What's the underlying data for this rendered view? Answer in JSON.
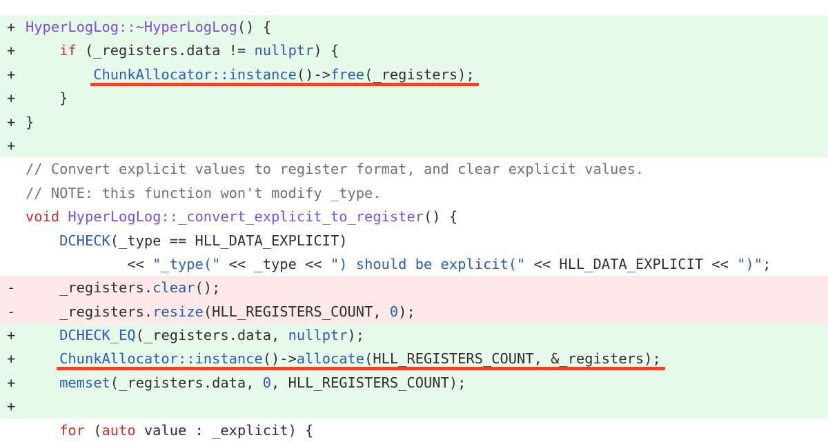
{
  "view": "code-diff",
  "colors": {
    "added_background": "#e8fbea",
    "removed_background": "#fde9e7",
    "context_background": "#ffffff",
    "highlight_underline": "#e8442a"
  },
  "lines": [
    {
      "kind": "add",
      "marker": "+",
      "tokens": [
        {
          "t": "HyperLogLog::~HyperLogLog",
          "c": "type"
        },
        {
          "t": "() {",
          "c": "plain"
        }
      ]
    },
    {
      "kind": "add",
      "marker": "+",
      "tokens": [
        {
          "t": "    ",
          "c": "plain"
        },
        {
          "t": "if",
          "c": "keyword"
        },
        {
          "t": " (_registers.data != ",
          "c": "plain"
        },
        {
          "t": "nullptr",
          "c": "func"
        },
        {
          "t": ") {",
          "c": "plain"
        }
      ]
    },
    {
      "kind": "add",
      "marker": "+",
      "highlight": true,
      "tokens": [
        {
          "t": "        ",
          "c": "plain"
        },
        {
          "t": "ChunkAllocator::instance",
          "c": "func"
        },
        {
          "t": "()->",
          "c": "plain"
        },
        {
          "t": "free",
          "c": "func"
        },
        {
          "t": "(_registers);",
          "c": "plain"
        }
      ]
    },
    {
      "kind": "add",
      "marker": "+",
      "tokens": [
        {
          "t": "    }",
          "c": "plain"
        }
      ]
    },
    {
      "kind": "add",
      "marker": "+",
      "tokens": [
        {
          "t": "}",
          "c": "plain"
        }
      ]
    },
    {
      "kind": "add",
      "marker": "+",
      "tokens": []
    },
    {
      "kind": "ctx",
      "marker": "",
      "tokens": [
        {
          "t": "// Convert explicit values to register format, and clear explicit values.",
          "c": "comment"
        }
      ]
    },
    {
      "kind": "ctx",
      "marker": "",
      "tokens": [
        {
          "t": "// NOTE: this function won't modify _type.",
          "c": "comment"
        }
      ]
    },
    {
      "kind": "ctx",
      "marker": "",
      "tokens": [
        {
          "t": "void",
          "c": "keyword"
        },
        {
          "t": " ",
          "c": "plain"
        },
        {
          "t": "HyperLogLog::_convert_explicit_to_register",
          "c": "type"
        },
        {
          "t": "() {",
          "c": "plain"
        }
      ]
    },
    {
      "kind": "ctx",
      "marker": "",
      "tokens": [
        {
          "t": "    ",
          "c": "plain"
        },
        {
          "t": "DCHECK",
          "c": "func"
        },
        {
          "t": "(_type == HLL_DATA_EXPLICIT)",
          "c": "plain"
        }
      ]
    },
    {
      "kind": "ctx",
      "marker": "",
      "tokens": [
        {
          "t": "            << ",
          "c": "plain"
        },
        {
          "t": "\"_type(\"",
          "c": "string"
        },
        {
          "t": " << _type << ",
          "c": "plain"
        },
        {
          "t": "\") should be explicit(\"",
          "c": "string"
        },
        {
          "t": " << HLL_DATA_EXPLICIT << ",
          "c": "plain"
        },
        {
          "t": "\")\"",
          "c": "string"
        },
        {
          "t": ";",
          "c": "plain"
        }
      ]
    },
    {
      "kind": "del",
      "marker": "-",
      "tokens": [
        {
          "t": "    _registers.",
          "c": "plain"
        },
        {
          "t": "clear",
          "c": "func"
        },
        {
          "t": "();",
          "c": "plain"
        }
      ]
    },
    {
      "kind": "del",
      "marker": "-",
      "tokens": [
        {
          "t": "    _registers.",
          "c": "plain"
        },
        {
          "t": "resize",
          "c": "func"
        },
        {
          "t": "(HLL_REGISTERS_COUNT, ",
          "c": "plain"
        },
        {
          "t": "0",
          "c": "number"
        },
        {
          "t": ");",
          "c": "plain"
        }
      ]
    },
    {
      "kind": "add",
      "marker": "+",
      "tokens": [
        {
          "t": "    ",
          "c": "plain"
        },
        {
          "t": "DCHECK_EQ",
          "c": "func"
        },
        {
          "t": "(_registers.data, ",
          "c": "plain"
        },
        {
          "t": "nullptr",
          "c": "func"
        },
        {
          "t": ");",
          "c": "plain"
        }
      ]
    },
    {
      "kind": "add",
      "marker": "+",
      "highlight": true,
      "tokens": [
        {
          "t": "    ",
          "c": "plain"
        },
        {
          "t": "ChunkAllocator::instance",
          "c": "func"
        },
        {
          "t": "()->",
          "c": "plain"
        },
        {
          "t": "allocate",
          "c": "func"
        },
        {
          "t": "(HLL_REGISTERS_COUNT, &_registers);",
          "c": "plain"
        }
      ]
    },
    {
      "kind": "add",
      "marker": "+",
      "tokens": [
        {
          "t": "    ",
          "c": "plain"
        },
        {
          "t": "memset",
          "c": "func"
        },
        {
          "t": "(_registers.data, ",
          "c": "plain"
        },
        {
          "t": "0",
          "c": "number"
        },
        {
          "t": ", HLL_REGISTERS_COUNT);",
          "c": "plain"
        }
      ]
    },
    {
      "kind": "add",
      "marker": "+",
      "tokens": []
    },
    {
      "kind": "ctx",
      "marker": "",
      "tokens": [
        {
          "t": "    ",
          "c": "plain"
        },
        {
          "t": "for",
          "c": "keyword"
        },
        {
          "t": " (",
          "c": "plain"
        },
        {
          "t": "auto",
          "c": "keyword"
        },
        {
          "t": " value : _explicit) {",
          "c": "plain"
        }
      ]
    }
  ]
}
